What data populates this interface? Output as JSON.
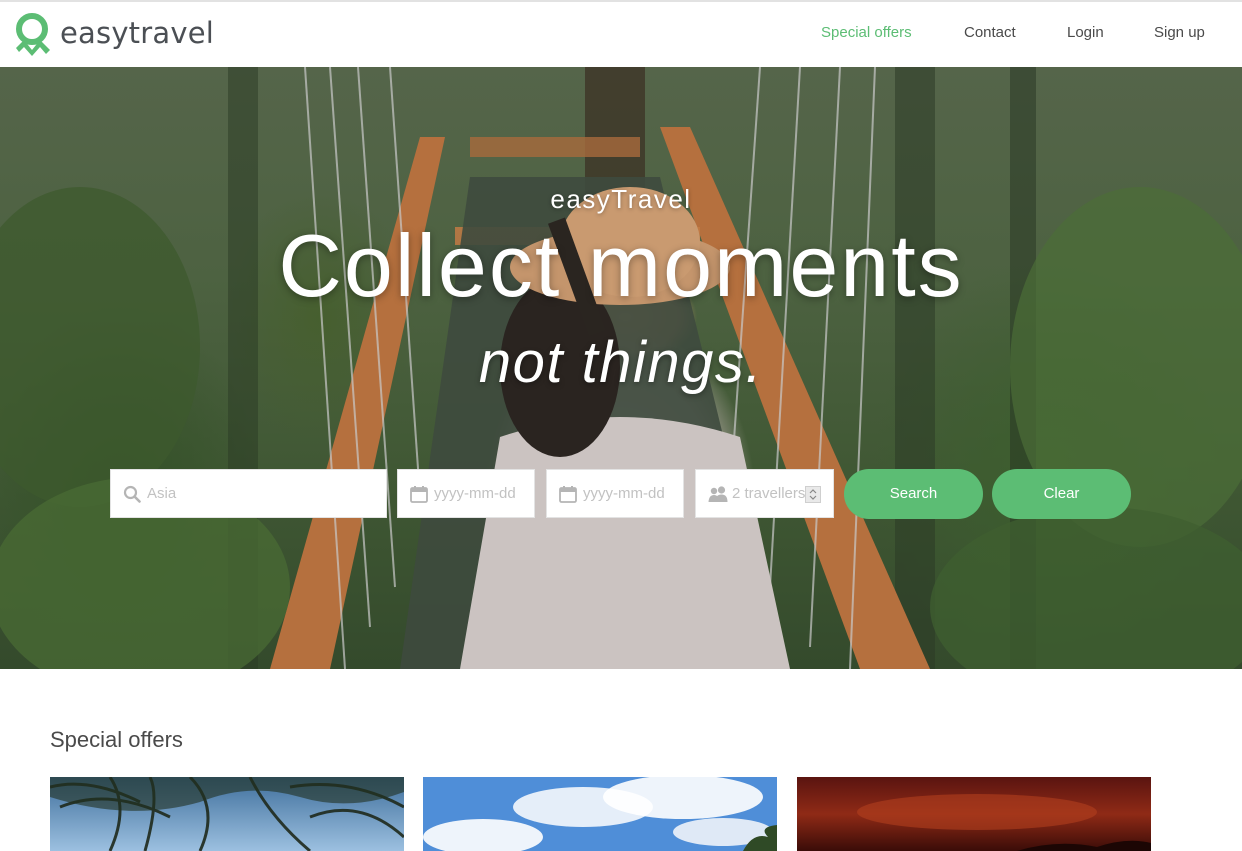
{
  "brand": {
    "logo_text": "easytravel",
    "accent": "#5cbd74",
    "logo_icon": "location-pin-ribbon-icon"
  },
  "nav": {
    "items": [
      {
        "label": "Special offers",
        "active": true
      },
      {
        "label": "Contact",
        "active": false
      },
      {
        "label": "Login",
        "active": false
      },
      {
        "label": "Sign up",
        "active": false
      }
    ]
  },
  "hero": {
    "kicker": "easyTravel",
    "title": "Collect moments",
    "subtitle": "not things.",
    "image": "woman with hat on forest suspension bridge"
  },
  "search": {
    "destination": {
      "placeholder": "Asia",
      "icon": "search-icon"
    },
    "from_date": {
      "placeholder": "yyyy-mm-dd",
      "icon": "calendar-icon"
    },
    "to_date": {
      "placeholder": "yyyy-mm-dd",
      "icon": "calendar-icon"
    },
    "travellers": {
      "placeholder": "2 travellers",
      "icon": "users-icon"
    },
    "search_label": "Search",
    "clear_label": "Clear"
  },
  "offers": {
    "title": "Special offers",
    "cards": [
      {
        "image": "palm trees against blue sky"
      },
      {
        "image": "blue sky with clouds and palm"
      },
      {
        "image": "red sunset sky"
      }
    ]
  }
}
